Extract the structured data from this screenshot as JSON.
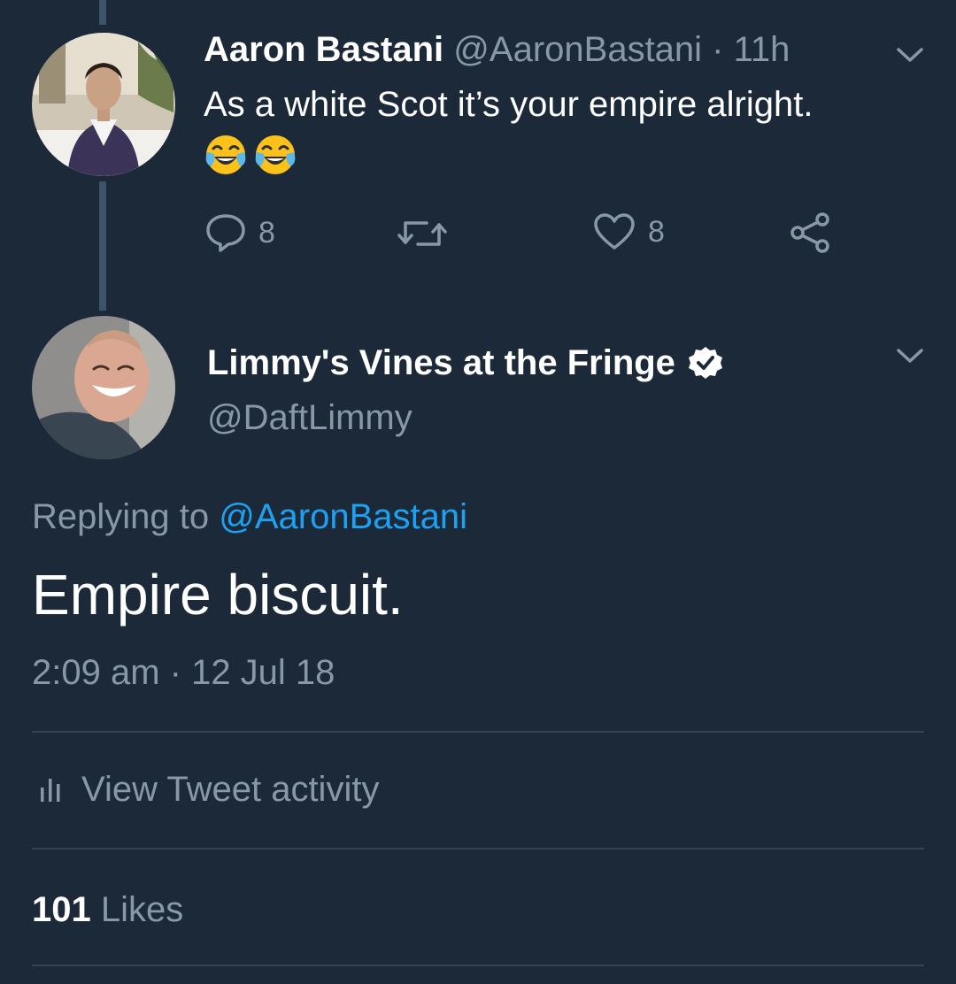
{
  "parent_tweet": {
    "display_name": "Aaron Bastani",
    "handle": "@AaronBastani",
    "separator": " · ",
    "age": "11h",
    "text": "As a white Scot it’s your empire alright.",
    "emojis": [
      "face-with-tears-of-joy",
      "face-with-tears-of-joy"
    ],
    "reply_count": "8",
    "like_count": "8"
  },
  "focused_tweet": {
    "display_name": "Limmy's Vines at the Fringe",
    "verified": true,
    "handle": "@DaftLimmy",
    "replying_prefix": "Replying to ",
    "replying_to": "@AaronBastani",
    "text": "Empire biscuit.",
    "time": "2:09 am",
    "date_separator": " · ",
    "date": "12 Jul 18",
    "activity_label": "View Tweet activity",
    "likes_count": "101",
    "likes_label": "Likes"
  },
  "colors": {
    "background": "#1c2938",
    "muted_text": "#8899a6",
    "link": "#1da1f2",
    "divider": "#38444d",
    "thread_line": "#3d5468"
  },
  "icons": [
    "reply-icon",
    "retweet-icon",
    "like-icon",
    "share-icon",
    "chevron-down-icon",
    "verified-badge-icon",
    "bar-chart-icon"
  ]
}
